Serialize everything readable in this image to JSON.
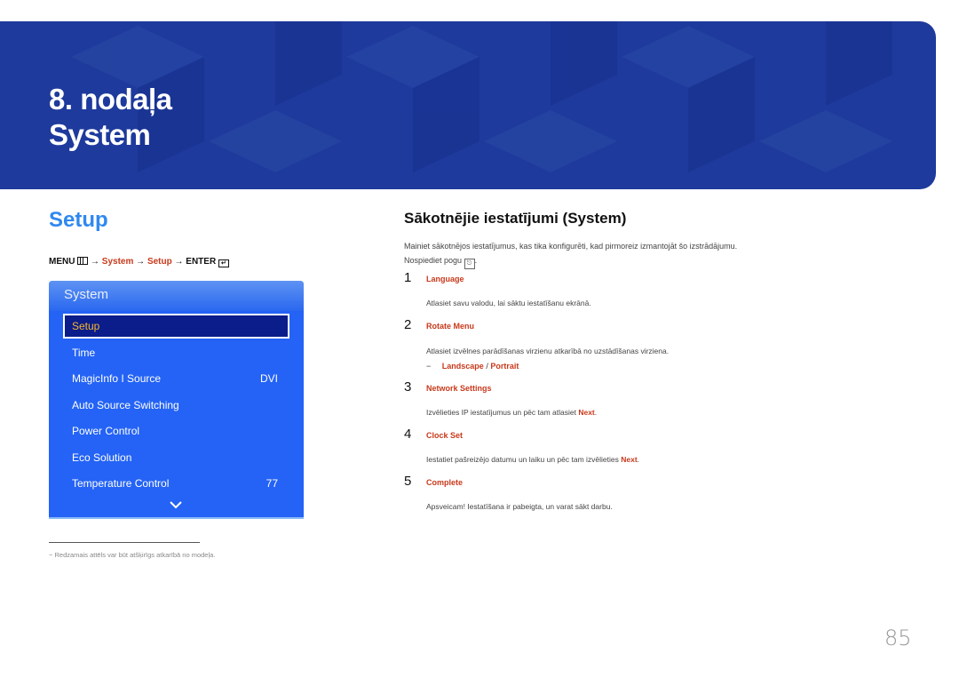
{
  "banner": {
    "chapter": "8. nodaļa",
    "title": "System",
    "color": "#1e3a9c"
  },
  "left": {
    "section_title": "Setup",
    "menu_path": {
      "menu": "MENU",
      "menu_icon": "menu-icon",
      "arrow": "→",
      "system": "System",
      "setup": "Setup",
      "enter": "ENTER",
      "enter_icon": "enter-icon"
    },
    "osd": {
      "title": "System",
      "items": [
        {
          "label": "Setup",
          "value": "",
          "selected": true
        },
        {
          "label": "Time",
          "value": ""
        },
        {
          "label": "MagicInfo I Source",
          "value": "DVI"
        },
        {
          "label": "Auto Source Switching",
          "value": ""
        },
        {
          "label": "Power Control",
          "value": ""
        },
        {
          "label": "Eco Solution",
          "value": ""
        },
        {
          "label": "Temperature Control",
          "value": "77"
        }
      ],
      "more_icon": "chevron-down-icon"
    },
    "footnote": "Redzamais attēls var būt atšķirīgs atkarībā no modeļa.",
    "footnote_dash": "−"
  },
  "right": {
    "heading": "Sākotnējie iestatījumi (System)",
    "intro": "Mainiet sākotnējos iestatījumus, kas tika konfigurēti, kad pirmoreiz izmantojāt šo izstrādājumu.",
    "press_prefix": "Nospiediet pogu",
    "press_suffix": ".",
    "steps": [
      {
        "num": "1",
        "title": "Language",
        "desc": "Atlasiet savu valodu, lai sāktu iestatīšanu ekrānā."
      },
      {
        "num": "2",
        "title": "Rotate Menu",
        "desc": "Atlasiet izvēlnes parādīšanas virzienu atkarībā no uzstādīšanas virziena.",
        "sub": {
          "dash": "−",
          "opt1": "Landscape",
          "sep": " / ",
          "opt2": "Portrait"
        }
      },
      {
        "num": "3",
        "title": "Network Settings",
        "desc": "Izvēlieties IP iestatījumus un pēc tam atlasiet ",
        "desc_bold": "Next",
        "desc_end": "."
      },
      {
        "num": "4",
        "title": "Clock Set",
        "desc": "Iestatiet pašreizējo datumu un laiku un pēc tam izvēlieties ",
        "desc_bold": "Next",
        "desc_end": "."
      },
      {
        "num": "5",
        "title": "Complete",
        "desc": "Apsveicam! Iestatīšana ir pabeigta, un varat sākt darbu."
      }
    ]
  },
  "page_number": "85",
  "colors": {
    "accent_blue": "#2f88f0",
    "accent_red": "#c8391b",
    "osd_blue": "#2463f5",
    "osd_selected": "#0a1d8a",
    "osd_selected_text": "#f7b630"
  }
}
